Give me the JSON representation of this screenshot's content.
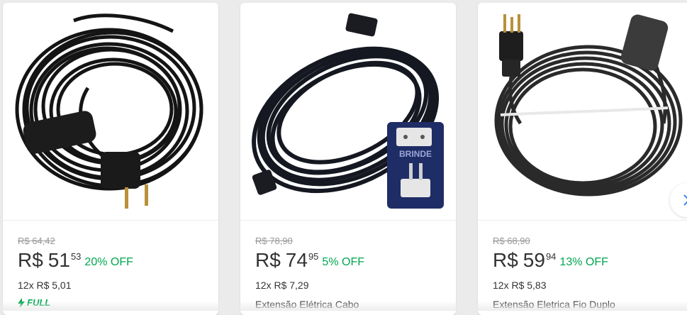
{
  "products": [
    {
      "old_price": "R$ 64,42",
      "currency": "R$",
      "price_int": "51",
      "price_cents": "53",
      "discount": "20% OFF",
      "installments": "12x R$ 5,01",
      "badge": "FULL",
      "title": ""
    },
    {
      "old_price": "R$ 78,90",
      "currency": "R$",
      "price_int": "74",
      "price_cents": "95",
      "discount": "5% OFF",
      "installments": "12x R$ 7,29",
      "badge": "",
      "title": "Extensão Elétrica Cabo",
      "image_badge": "BRINDE"
    },
    {
      "old_price": "R$ 68,90",
      "currency": "R$",
      "price_int": "59",
      "price_cents": "94",
      "discount": "13% OFF",
      "installments": "12x R$ 5,83",
      "badge": "",
      "title": "Extensão Eletrica Fio Duplo"
    }
  ],
  "colors": {
    "discount": "#00a650",
    "full_badge": "#00a650",
    "background": "#ebebeb"
  },
  "icons": [
    "lightning-icon",
    "chevron-right-icon"
  ]
}
